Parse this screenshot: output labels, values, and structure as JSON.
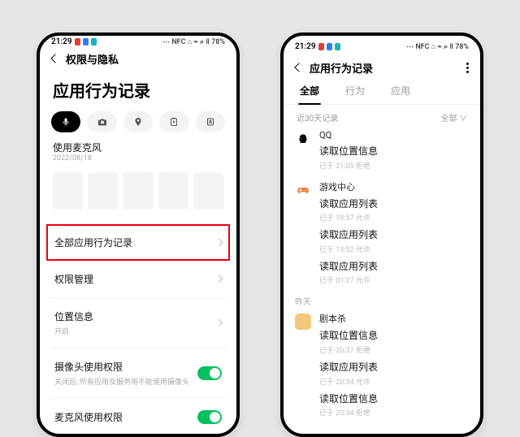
{
  "status": {
    "time": "21:29",
    "right": "⋯ NFC ⌂ ⌁ ⌕ ‖  78%"
  },
  "colors": {
    "accent": "#06c160",
    "highlight": "#e60012"
  },
  "left": {
    "header": "权限与隐私",
    "title": "应用行为记录",
    "chips": [
      "mic",
      "camera",
      "location",
      "clipboard",
      "contacts"
    ],
    "sub": {
      "label": "使用麦克风",
      "date": "2022/08/18"
    },
    "allrecords": "全部应用行为记录",
    "perm": "权限管理",
    "loc": {
      "label": "位置信息",
      "state": "开启"
    },
    "cam": {
      "label": "摄像头使用权限",
      "note": "关闭后, 所有应用及服务将不能使用摄像头"
    },
    "microw": "麦克风使用权限"
  },
  "right": {
    "header": "应用行为记录",
    "tabs": {
      "all": "全部",
      "behavior": "行为",
      "app": "应用"
    },
    "filterL": "近30天记录",
    "filterR": "全部 ∨",
    "apps": [
      {
        "name": "QQ",
        "icon": "qq",
        "events": [
          {
            "t": "读取位置信息",
            "s": "已于 21:05 拒绝"
          }
        ]
      },
      {
        "name": "游戏中心",
        "icon": "game",
        "events": [
          {
            "t": "读取应用列表",
            "s": "已于 19:57 允许"
          },
          {
            "t": "读取应用列表",
            "s": "已于 13:52 允许"
          },
          {
            "t": "读取应用列表",
            "s": "已于 01:27 允许"
          }
        ]
      },
      {
        "day": "昨天"
      },
      {
        "name": "剧本杀",
        "icon": "script",
        "events": [
          {
            "t": "读取位置信息",
            "s": "已于 20:37 拒绝"
          },
          {
            "t": "读取应用列表",
            "s": "已于 20:34 允许"
          },
          {
            "t": "读取位置信息",
            "s": "已于 20:34 拒绝"
          }
        ]
      }
    ]
  }
}
